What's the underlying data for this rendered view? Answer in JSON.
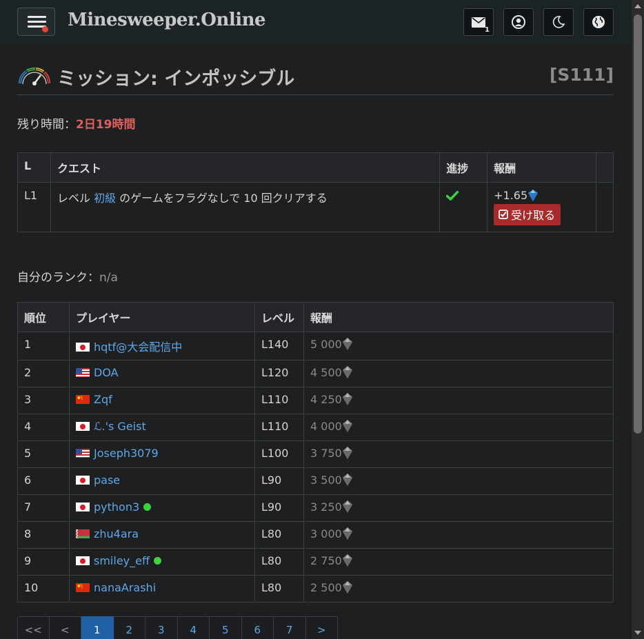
{
  "navbar": {
    "brand": "Minesweeper.Online",
    "mail_count": "1"
  },
  "mission": {
    "title": "ミッション: インポッシブル",
    "season": "[S111]",
    "time_label": "残り時間：",
    "time_value": "2日19時間"
  },
  "quest_table": {
    "headers": [
      "L",
      "クエスト",
      "進捗",
      "報酬"
    ],
    "rows": [
      {
        "level": "L1",
        "quest_pre": "レベル ",
        "quest_link": "初級",
        "quest_post": " のゲームをフラグなしで 10 回クリアする",
        "reward": "+1.65",
        "claim_label": "受け取る"
      }
    ]
  },
  "my_rank": {
    "label": "自分のランク：",
    "value": "n/a"
  },
  "rank_table": {
    "headers": [
      "順位",
      "プレイヤー",
      "レベル",
      "報酬"
    ],
    "rows": [
      {
        "rank": "1",
        "flag": "jp",
        "name": "hqtf@大会配信中",
        "online": false,
        "level": "L140",
        "reward": "5 000"
      },
      {
        "rank": "2",
        "flag": "us",
        "name": "DOA",
        "online": false,
        "level": "L120",
        "reward": "4 500"
      },
      {
        "rank": "3",
        "flag": "cn",
        "name": "Zqf",
        "online": false,
        "level": "L110",
        "reward": "4 250"
      },
      {
        "rank": "4",
        "flag": "jp",
        "name": "ℒ.'s Geist",
        "online": false,
        "level": "L110",
        "reward": "4 000"
      },
      {
        "rank": "5",
        "flag": "us",
        "name": "Joseph3079",
        "online": false,
        "level": "L100",
        "reward": "3 750"
      },
      {
        "rank": "6",
        "flag": "jp",
        "name": "pase",
        "online": false,
        "level": "L90",
        "reward": "3 500"
      },
      {
        "rank": "7",
        "flag": "jp",
        "name": "python3",
        "online": true,
        "level": "L90",
        "reward": "3 250"
      },
      {
        "rank": "8",
        "flag": "by",
        "name": "zhu4ara",
        "online": false,
        "level": "L80",
        "reward": "3 000"
      },
      {
        "rank": "9",
        "flag": "jp",
        "name": "smiley_eff",
        "online": true,
        "level": "L80",
        "reward": "2 750"
      },
      {
        "rank": "10",
        "flag": "cn",
        "name": "nanaArashi",
        "online": false,
        "level": "L80",
        "reward": "2 500"
      }
    ]
  },
  "pagination": {
    "items": [
      "<<",
      "<",
      "1",
      "2",
      "3",
      "4",
      "5",
      "6",
      "7",
      ">"
    ],
    "active": "1"
  },
  "colors": {
    "accent_link": "#5fa8e8",
    "time_red": "#e06060",
    "claim_red": "#a82a2a",
    "online_green": "#3fd13f",
    "page_active": "#2060a6"
  }
}
